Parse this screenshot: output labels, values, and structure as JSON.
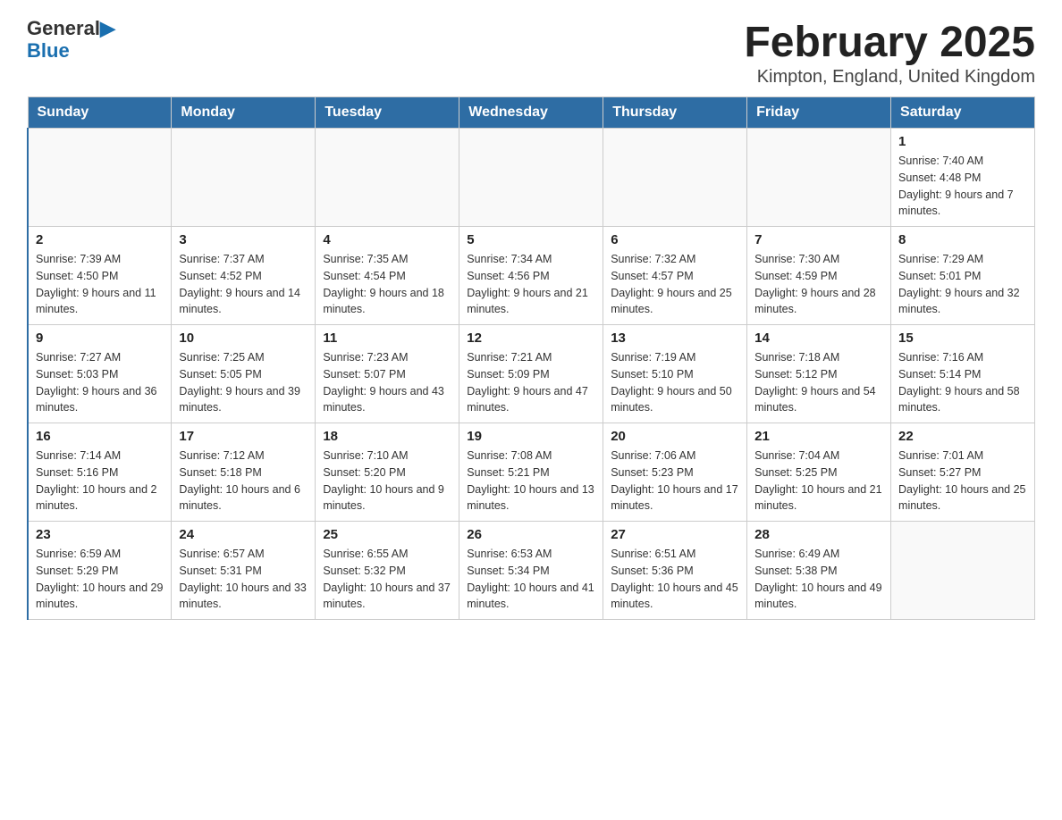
{
  "logo": {
    "general": "General",
    "blue": "Blue"
  },
  "header": {
    "title": "February 2025",
    "location": "Kimpton, England, United Kingdom"
  },
  "weekdays": [
    "Sunday",
    "Monday",
    "Tuesday",
    "Wednesday",
    "Thursday",
    "Friday",
    "Saturday"
  ],
  "weeks": [
    [
      {
        "day": "",
        "info": ""
      },
      {
        "day": "",
        "info": ""
      },
      {
        "day": "",
        "info": ""
      },
      {
        "day": "",
        "info": ""
      },
      {
        "day": "",
        "info": ""
      },
      {
        "day": "",
        "info": ""
      },
      {
        "day": "1",
        "info": "Sunrise: 7:40 AM\nSunset: 4:48 PM\nDaylight: 9 hours and 7 minutes."
      }
    ],
    [
      {
        "day": "2",
        "info": "Sunrise: 7:39 AM\nSunset: 4:50 PM\nDaylight: 9 hours and 11 minutes."
      },
      {
        "day": "3",
        "info": "Sunrise: 7:37 AM\nSunset: 4:52 PM\nDaylight: 9 hours and 14 minutes."
      },
      {
        "day": "4",
        "info": "Sunrise: 7:35 AM\nSunset: 4:54 PM\nDaylight: 9 hours and 18 minutes."
      },
      {
        "day": "5",
        "info": "Sunrise: 7:34 AM\nSunset: 4:56 PM\nDaylight: 9 hours and 21 minutes."
      },
      {
        "day": "6",
        "info": "Sunrise: 7:32 AM\nSunset: 4:57 PM\nDaylight: 9 hours and 25 minutes."
      },
      {
        "day": "7",
        "info": "Sunrise: 7:30 AM\nSunset: 4:59 PM\nDaylight: 9 hours and 28 minutes."
      },
      {
        "day": "8",
        "info": "Sunrise: 7:29 AM\nSunset: 5:01 PM\nDaylight: 9 hours and 32 minutes."
      }
    ],
    [
      {
        "day": "9",
        "info": "Sunrise: 7:27 AM\nSunset: 5:03 PM\nDaylight: 9 hours and 36 minutes."
      },
      {
        "day": "10",
        "info": "Sunrise: 7:25 AM\nSunset: 5:05 PM\nDaylight: 9 hours and 39 minutes."
      },
      {
        "day": "11",
        "info": "Sunrise: 7:23 AM\nSunset: 5:07 PM\nDaylight: 9 hours and 43 minutes."
      },
      {
        "day": "12",
        "info": "Sunrise: 7:21 AM\nSunset: 5:09 PM\nDaylight: 9 hours and 47 minutes."
      },
      {
        "day": "13",
        "info": "Sunrise: 7:19 AM\nSunset: 5:10 PM\nDaylight: 9 hours and 50 minutes."
      },
      {
        "day": "14",
        "info": "Sunrise: 7:18 AM\nSunset: 5:12 PM\nDaylight: 9 hours and 54 minutes."
      },
      {
        "day": "15",
        "info": "Sunrise: 7:16 AM\nSunset: 5:14 PM\nDaylight: 9 hours and 58 minutes."
      }
    ],
    [
      {
        "day": "16",
        "info": "Sunrise: 7:14 AM\nSunset: 5:16 PM\nDaylight: 10 hours and 2 minutes."
      },
      {
        "day": "17",
        "info": "Sunrise: 7:12 AM\nSunset: 5:18 PM\nDaylight: 10 hours and 6 minutes."
      },
      {
        "day": "18",
        "info": "Sunrise: 7:10 AM\nSunset: 5:20 PM\nDaylight: 10 hours and 9 minutes."
      },
      {
        "day": "19",
        "info": "Sunrise: 7:08 AM\nSunset: 5:21 PM\nDaylight: 10 hours and 13 minutes."
      },
      {
        "day": "20",
        "info": "Sunrise: 7:06 AM\nSunset: 5:23 PM\nDaylight: 10 hours and 17 minutes."
      },
      {
        "day": "21",
        "info": "Sunrise: 7:04 AM\nSunset: 5:25 PM\nDaylight: 10 hours and 21 minutes."
      },
      {
        "day": "22",
        "info": "Sunrise: 7:01 AM\nSunset: 5:27 PM\nDaylight: 10 hours and 25 minutes."
      }
    ],
    [
      {
        "day": "23",
        "info": "Sunrise: 6:59 AM\nSunset: 5:29 PM\nDaylight: 10 hours and 29 minutes."
      },
      {
        "day": "24",
        "info": "Sunrise: 6:57 AM\nSunset: 5:31 PM\nDaylight: 10 hours and 33 minutes."
      },
      {
        "day": "25",
        "info": "Sunrise: 6:55 AM\nSunset: 5:32 PM\nDaylight: 10 hours and 37 minutes."
      },
      {
        "day": "26",
        "info": "Sunrise: 6:53 AM\nSunset: 5:34 PM\nDaylight: 10 hours and 41 minutes."
      },
      {
        "day": "27",
        "info": "Sunrise: 6:51 AM\nSunset: 5:36 PM\nDaylight: 10 hours and 45 minutes."
      },
      {
        "day": "28",
        "info": "Sunrise: 6:49 AM\nSunset: 5:38 PM\nDaylight: 10 hours and 49 minutes."
      },
      {
        "day": "",
        "info": ""
      }
    ]
  ]
}
